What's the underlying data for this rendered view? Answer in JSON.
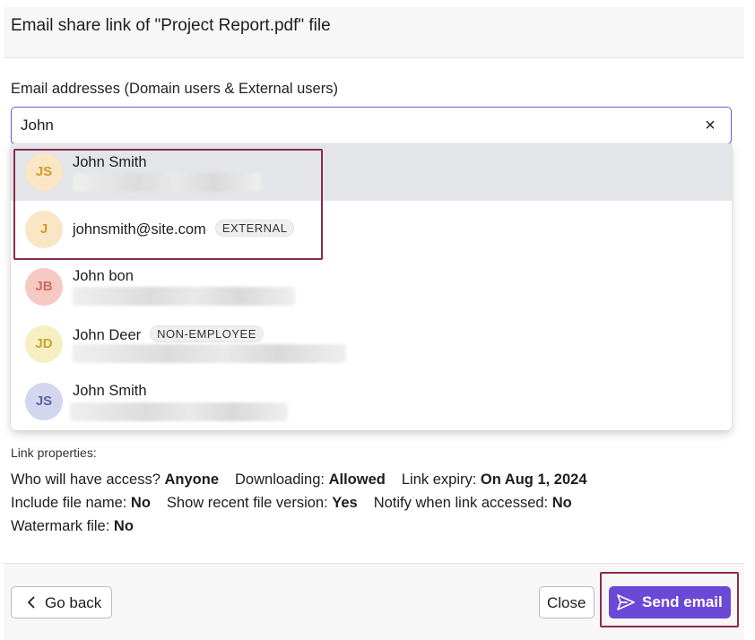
{
  "dialog": {
    "title": "Email share link of \"Project Report.pdf\" file"
  },
  "email_field": {
    "label": "Email addresses (Domain users & External users)",
    "value": "John",
    "clear_icon": "close-icon"
  },
  "suggestions": [
    {
      "initials": "JS",
      "name": "John Smith",
      "badge": "",
      "avatar_bg": "#f9e6c4",
      "avatar_fg": "#d29a2c",
      "highlighted": true
    },
    {
      "initials": "J",
      "name": "johnsmith@site.com",
      "badge": "EXTERNAL",
      "avatar_bg": "#f9e6c4",
      "avatar_fg": "#d29a2c",
      "highlighted": false
    },
    {
      "initials": "JB",
      "name": "John bon",
      "badge": "",
      "avatar_bg": "#f6c9c4",
      "avatar_fg": "#d06a60",
      "highlighted": false
    },
    {
      "initials": "JD",
      "name": "John Deer",
      "badge": "NON-EMPLOYEE",
      "avatar_bg": "#f6efc2",
      "avatar_fg": "#c4a52e",
      "highlighted": false
    },
    {
      "initials": "JS",
      "name": "John Smith",
      "badge": "",
      "avatar_bg": "#d3d7ee",
      "avatar_fg": "#5a63a8",
      "highlighted": false
    }
  ],
  "link_properties": {
    "heading": "Link properties:",
    "line1": [
      {
        "label": "Who will have access? ",
        "value": "Anyone"
      },
      {
        "label": "Downloading: ",
        "value": "Allowed"
      },
      {
        "label": "Link expiry: ",
        "value": "On Aug 1, 2024"
      }
    ],
    "line2": [
      {
        "label": "Include file name: ",
        "value": "No"
      },
      {
        "label": "Show recent file version: ",
        "value": "Yes"
      },
      {
        "label": "Notify when link accessed: ",
        "value": "No"
      }
    ],
    "line3": [
      {
        "label": "Watermark file: ",
        "value": "No"
      }
    ]
  },
  "footer": {
    "back_label": "Go back",
    "close_label": "Close",
    "send_label": "Send email",
    "accent_color": "#6b48d6",
    "highlight_color": "#8b2a4f"
  }
}
